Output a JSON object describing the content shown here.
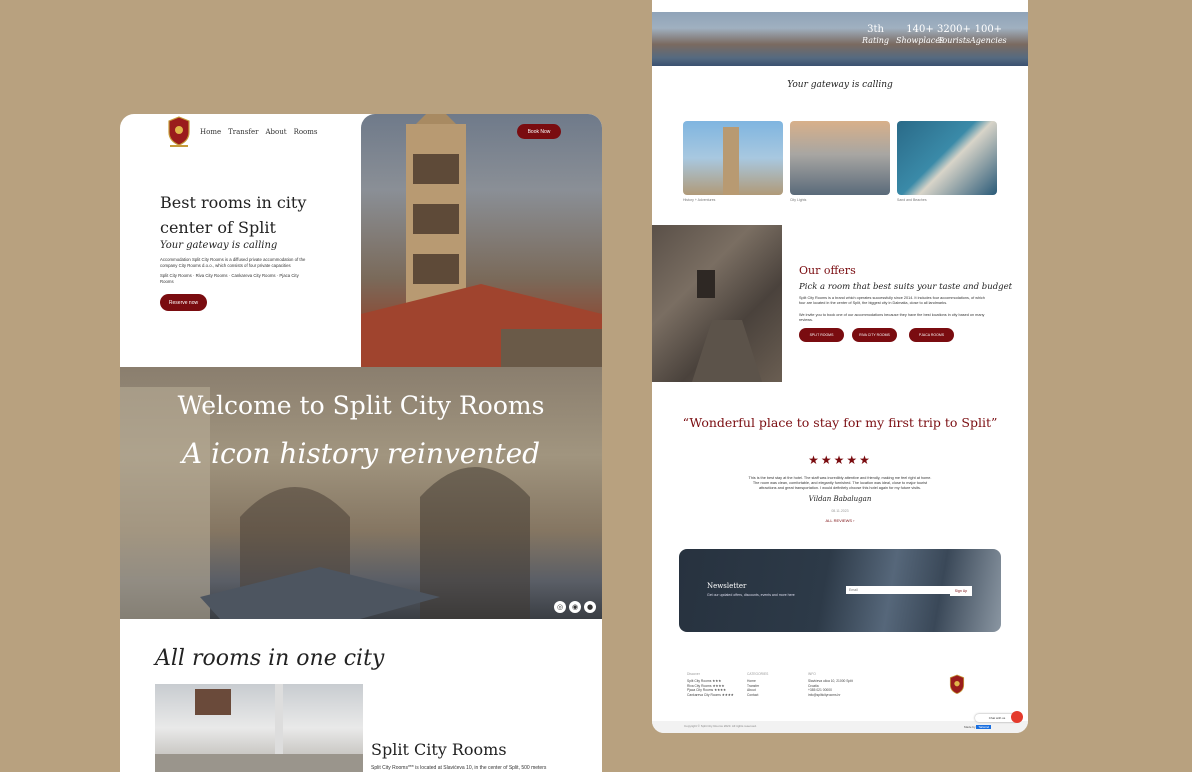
{
  "nav": {
    "items": [
      "Home",
      "Transfer",
      "About",
      "Rooms"
    ],
    "book": "Book Now"
  },
  "hero": {
    "title": "Best rooms in city center of Split",
    "subtitle": "Your gateway is calling",
    "desc": "Accommodation Split City Rooms is a diffused private accommodation of the company City Rooms d.o.o., which consists of four private capacities",
    "list": "Split City Rooms · Riva City Rooms · Cankareva City Rooms · Pjaca City Rooms",
    "reserve": "Reserve now"
  },
  "welcome": {
    "title": "Welcome to Split City Rooms",
    "subtitle": "A icon history reinvented"
  },
  "rooms": {
    "heading": "All rooms in one city",
    "title": "Split City Rooms",
    "desc": "Split City Rooms*** is located at Slavićeva 10, in the center of Split, 500 meters"
  },
  "stats": [
    {
      "num": "3th",
      "label": "Rating"
    },
    {
      "num": "140+",
      "label": "Showplaces"
    },
    {
      "num": "3200+",
      "label": "Tourists"
    },
    {
      "num": "100+",
      "label": "Agencies"
    }
  ],
  "gateway": "Your gateway is calling",
  "gallery": [
    {
      "caption": "History + Adventures"
    },
    {
      "caption": "City Lights"
    },
    {
      "caption": "Sand and Beaches"
    }
  ],
  "offers": {
    "title": "Our offers",
    "subtitle": "Pick a room that best suits your taste and budget",
    "desc1": "Split City Rooms is a brand which operates successfully since 2014. It includes four accommodations, of which four are located in the center of Split, the biggest city in Dalmatia, close to all landmarks.",
    "desc2": "We invite you to book one of our accommodations because they have the best locations in city based on many reviews.",
    "buttons": [
      "SPLIT ROOMS",
      "RIVA CITY ROOMS",
      "PJACA ROOMS"
    ]
  },
  "review": {
    "quote": "“Wonderful place to stay for my first trip to Split”",
    "stars": "★★★★★",
    "text": "This is the best stay at the hotel. The staff was incredibly attentive and friendly, making me feel right at home. The room was clean, comfortable, and elegantly furnished. The location was ideal, close to major tourist attractions and great transportation. I would definitely choose this hotel again for my future visits.",
    "author": "Vildan Babalugan",
    "date": "08.11.2023",
    "link": "ALL REVIEWS ›"
  },
  "newsletter": {
    "title": "Newsletter",
    "desc": "Get our updated offers, discounts, events and more here",
    "placeholder": "Email",
    "button": "Sign Up"
  },
  "footer": {
    "col1": {
      "head": "Discover",
      "items": [
        "Split City Rooms ★★★",
        "Riva City Rooms ★★★★",
        "Pjaca City Rooms ★★★★",
        "Cankareva City Rooms ★★★★"
      ]
    },
    "col2": {
      "head": "CATEGORIES",
      "items": [
        "Home",
        "Transfer",
        "About",
        "Contact"
      ]
    },
    "col3": {
      "head": "INFO",
      "items": [
        "Slavićeva ulica 10, 21000 Split",
        "Croatia",
        "+385 021 00000",
        "info@splitcityrooms.hr"
      ]
    },
    "copy": "Copyright © Split City Rooms 2023. All rights reserved.",
    "chat": "Chat with us",
    "powered": "Made by",
    "powered_brand": "Tailwind"
  }
}
